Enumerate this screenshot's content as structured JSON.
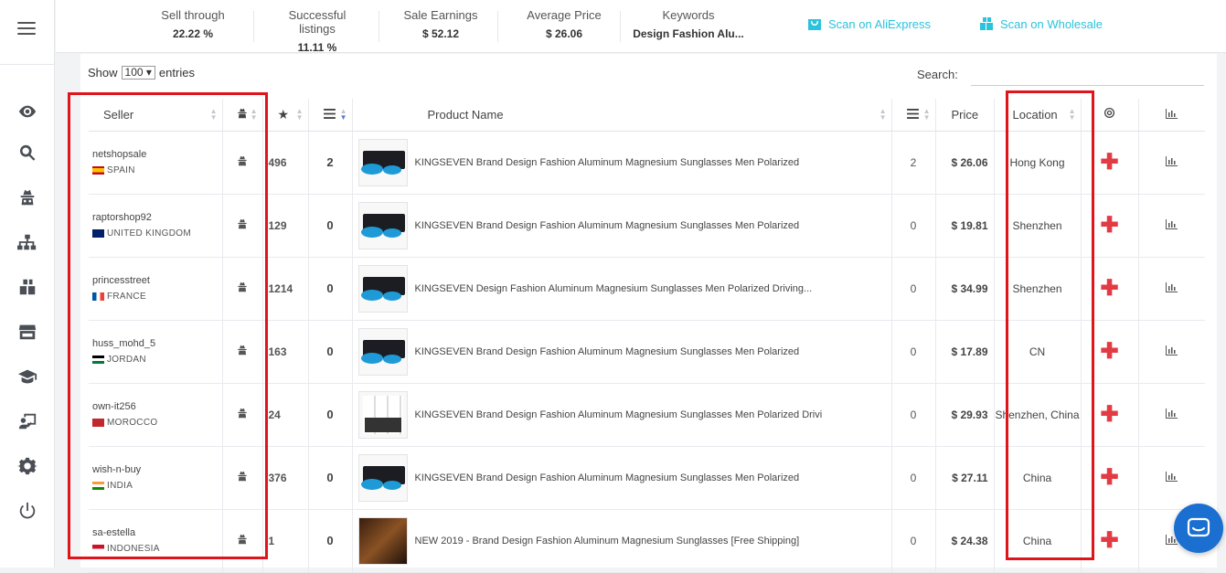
{
  "stats": [
    {
      "label": "Sell through",
      "value": "22.22 %"
    },
    {
      "label": "Successful listings",
      "value": "11.11 %"
    },
    {
      "label": "Sale Earnings",
      "value": "$ 52.12"
    },
    {
      "label": "Average Price",
      "value": "$ 26.06"
    },
    {
      "label": "Keywords",
      "value": "Design Fashion Alu..."
    }
  ],
  "scan_aliexpress": "Scan on AliExpress",
  "scan_wholesale": "Scan on Wholesale",
  "show_label": "Show",
  "show_value": "100 ▾",
  "entries_label": "entries",
  "search_label": "Search:",
  "columns": {
    "seller": "Seller",
    "product": "Product Name",
    "price": "Price",
    "location": "Location"
  },
  "rows": [
    {
      "seller": "netshopsale",
      "country": "SPAIN",
      "rating": "496",
      "sold": "2",
      "product": "KINGSEVEN Brand Design Fashion Aluminum Magnesium Sunglasses Men Polarized",
      "count": "2",
      "price": "$ 26.06",
      "location": "Hong Kong"
    },
    {
      "seller": "raptorshop92",
      "country": "UNITED KINGDOM",
      "rating": "129",
      "sold": "0",
      "product": "KINGSEVEN Brand Design Fashion Aluminum Magnesium Sunglasses Men Polarized",
      "count": "0",
      "price": "$ 19.81",
      "location": "Shenzhen"
    },
    {
      "seller": "princesstreet",
      "country": "FRANCE",
      "rating": "1214",
      "sold": "0",
      "product": "KINGSEVEN Design Fashion Aluminum Magnesium Sunglasses Men Polarized Driving...",
      "count": "0",
      "price": "$ 34.99",
      "location": "Shenzhen"
    },
    {
      "seller": "huss_mohd_5",
      "country": "JORDAN",
      "rating": "163",
      "sold": "0",
      "product": "KINGSEVEN Brand Design Fashion Aluminum Magnesium Sunglasses Men Polarized",
      "count": "0",
      "price": "$ 17.89",
      "location": "CN"
    },
    {
      "seller": "own-it256",
      "country": "MOROCCO",
      "rating": "24",
      "sold": "0",
      "product": "KINGSEVEN Brand Design Fashion Aluminum Magnesium Sunglasses Men Polarized Drivi",
      "count": "0",
      "price": "$ 29.93",
      "location": "Shenzhen, China"
    },
    {
      "seller": "wish-n-buy",
      "country": "INDIA",
      "rating": "376",
      "sold": "0",
      "product": "KINGSEVEN Brand Design Fashion Aluminum Magnesium Sunglasses Men Polarized",
      "count": "0",
      "price": "$ 27.11",
      "location": "China"
    },
    {
      "seller": "sa-estella",
      "country": "INDONESIA",
      "rating": "1",
      "sold": "0",
      "product": "NEW 2019 - Brand Design Fashion Aluminum Magnesium Sunglasses [Free Shipping]",
      "count": "0",
      "price": "$ 24.38",
      "location": "China"
    }
  ],
  "colors": {
    "accent": "#2bc3dc",
    "highlight": "#e0151c",
    "plus": "#e33b44",
    "chat": "#1a6fd1"
  }
}
